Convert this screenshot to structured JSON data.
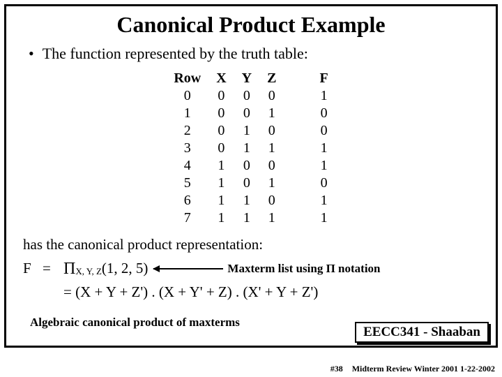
{
  "title": "Canonical Product Example",
  "bullet": "The function represented by the truth table:",
  "table": {
    "headers": {
      "row": "Row",
      "x": "X",
      "y": "Y",
      "z": "Z",
      "f": "F"
    },
    "r0": {
      "row": "0",
      "x": "0",
      "y": "0",
      "z": "0",
      "f": "1"
    },
    "r1": {
      "row": "1",
      "x": "0",
      "y": "0",
      "z": "1",
      "f": "0"
    },
    "r2": {
      "row": "2",
      "x": "0",
      "y": "1",
      "z": "0",
      "f": "0"
    },
    "r3": {
      "row": "3",
      "x": "0",
      "y": "1",
      "z": "1",
      "f": "1"
    },
    "r4": {
      "row": "4",
      "x": "1",
      "y": "0",
      "z": "0",
      "f": "1"
    },
    "r5": {
      "row": "5",
      "x": "1",
      "y": "0",
      "z": "1",
      "f": "0"
    },
    "r6": {
      "row": "6",
      "x": "1",
      "y": "1",
      "z": "0",
      "f": "1"
    },
    "r7": {
      "row": "7",
      "x": "1",
      "y": "1",
      "z": "1",
      "f": "1"
    }
  },
  "text": {
    "has_repr": "has the canonical product representation:",
    "F": "F",
    "eq": "=",
    "pi": "Π",
    "sub": "X, Y, Z",
    "args": " (1, 2, 5)",
    "annot": "Maxterm list using Π  notation",
    "expansion": "= (X + Y + Z') . (X + Y' + Z) . (X' + Y + Z')",
    "caption": "Algebraic canonical product of maxterms"
  },
  "footer": {
    "course": "EECC341 - Shaaban",
    "slidenum": "#38",
    "rest": "Midterm Review  Winter 2001  1-22-2002"
  }
}
